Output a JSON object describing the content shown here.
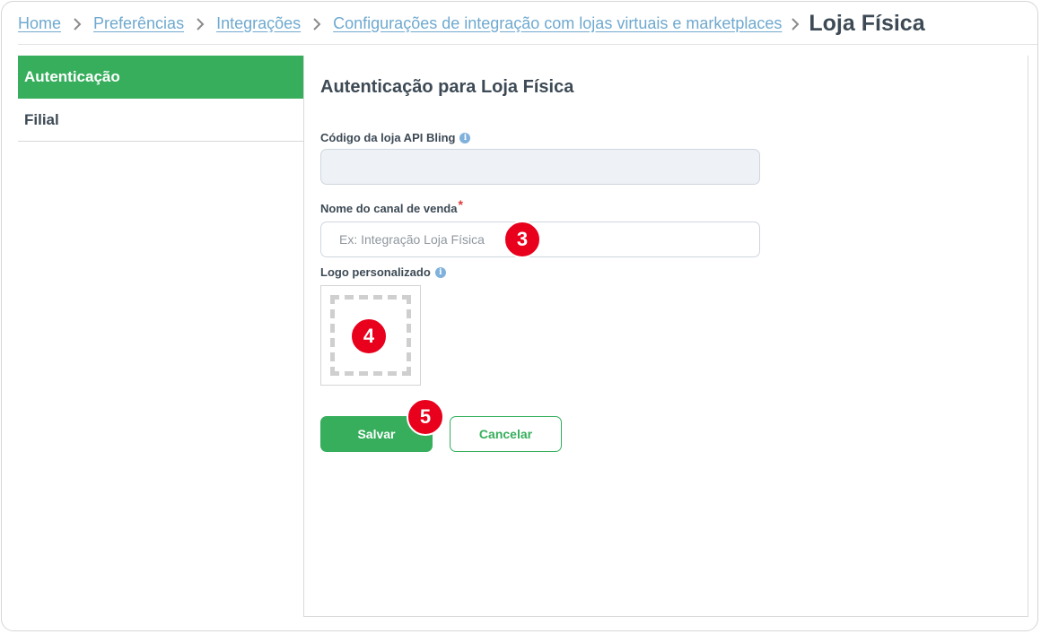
{
  "breadcrumb": {
    "links": [
      "Home",
      "Preferências",
      "Integrações",
      "Configurações de integração com lojas virtuais e marketplaces"
    ],
    "current": "Loja Física"
  },
  "sidebar": {
    "items": [
      {
        "label": "Autenticação",
        "active": true
      },
      {
        "label": "Filial",
        "active": false
      }
    ]
  },
  "form": {
    "title": "Autenticação para Loja Física",
    "store_code": {
      "label": "Código da loja API Bling",
      "value": ""
    },
    "channel_name": {
      "label": "Nome do canal de venda",
      "required_mark": "*",
      "placeholder": "Ex: Integração Loja Física",
      "value": ""
    },
    "logo": {
      "label": "Logo personalizado"
    },
    "save_label": "Salvar",
    "cancel_label": "Cancelar"
  },
  "annotations": {
    "step3": "3",
    "step4": "4",
    "step5": "5"
  },
  "colors": {
    "accent": "#36ae5c",
    "link": "#6fa9cf",
    "badge": "#e8001c",
    "text": "#3d4a55"
  },
  "icons": {
    "chevron": "chevron-right-icon",
    "info": "info-icon"
  }
}
